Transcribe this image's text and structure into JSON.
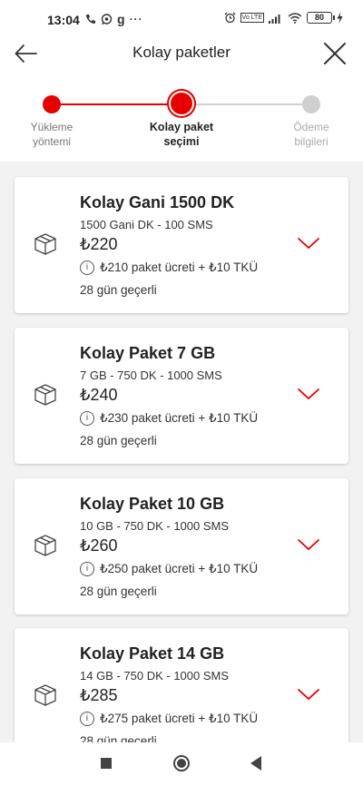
{
  "status_bar": {
    "time": "13:04",
    "left_icons": [
      "phone-icon",
      "whatsapp-icon",
      "g-app-icon",
      "more-icon"
    ],
    "battery": "80"
  },
  "header": {
    "title": "Kolay paketler"
  },
  "stepper": {
    "steps": [
      {
        "line1": "Yükleme",
        "line2": "yöntemi",
        "state": "done"
      },
      {
        "line1": "Kolay paket",
        "line2": "seçimi",
        "state": "active"
      },
      {
        "line1": "Ödeme",
        "line2": "bilgileri",
        "state": "pending"
      }
    ]
  },
  "packages": [
    {
      "title": "Kolay Gani 1500 DK",
      "subtitle": "1500 Gani DK - 100 SMS",
      "price": "₺220",
      "fee_info": "₺210 paket ücreti + ₺10 TKÜ",
      "validity": "28 gün geçerli"
    },
    {
      "title": "Kolay Paket 7 GB",
      "subtitle": "7 GB - 750 DK - 1000 SMS",
      "price": "₺240",
      "fee_info": "₺230 paket ücreti + ₺10 TKÜ",
      "validity": "28 gün geçerli"
    },
    {
      "title": "Kolay Paket 10 GB",
      "subtitle": "10 GB - 750 DK - 1000 SMS",
      "price": "₺260",
      "fee_info": "₺250 paket ücreti + ₺10 TKÜ",
      "validity": "28 gün geçerli"
    },
    {
      "title": "Kolay Paket 14 GB",
      "subtitle": "14 GB - 750 DK - 1000 SMS",
      "price": "₺285",
      "fee_info": "₺275 paket ücreti + ₺10 TKÜ",
      "validity": "28 gün geçerli"
    }
  ],
  "colors": {
    "accent": "#e60000",
    "inactive": "#cfcfcf",
    "background": "#f2f2f2"
  }
}
